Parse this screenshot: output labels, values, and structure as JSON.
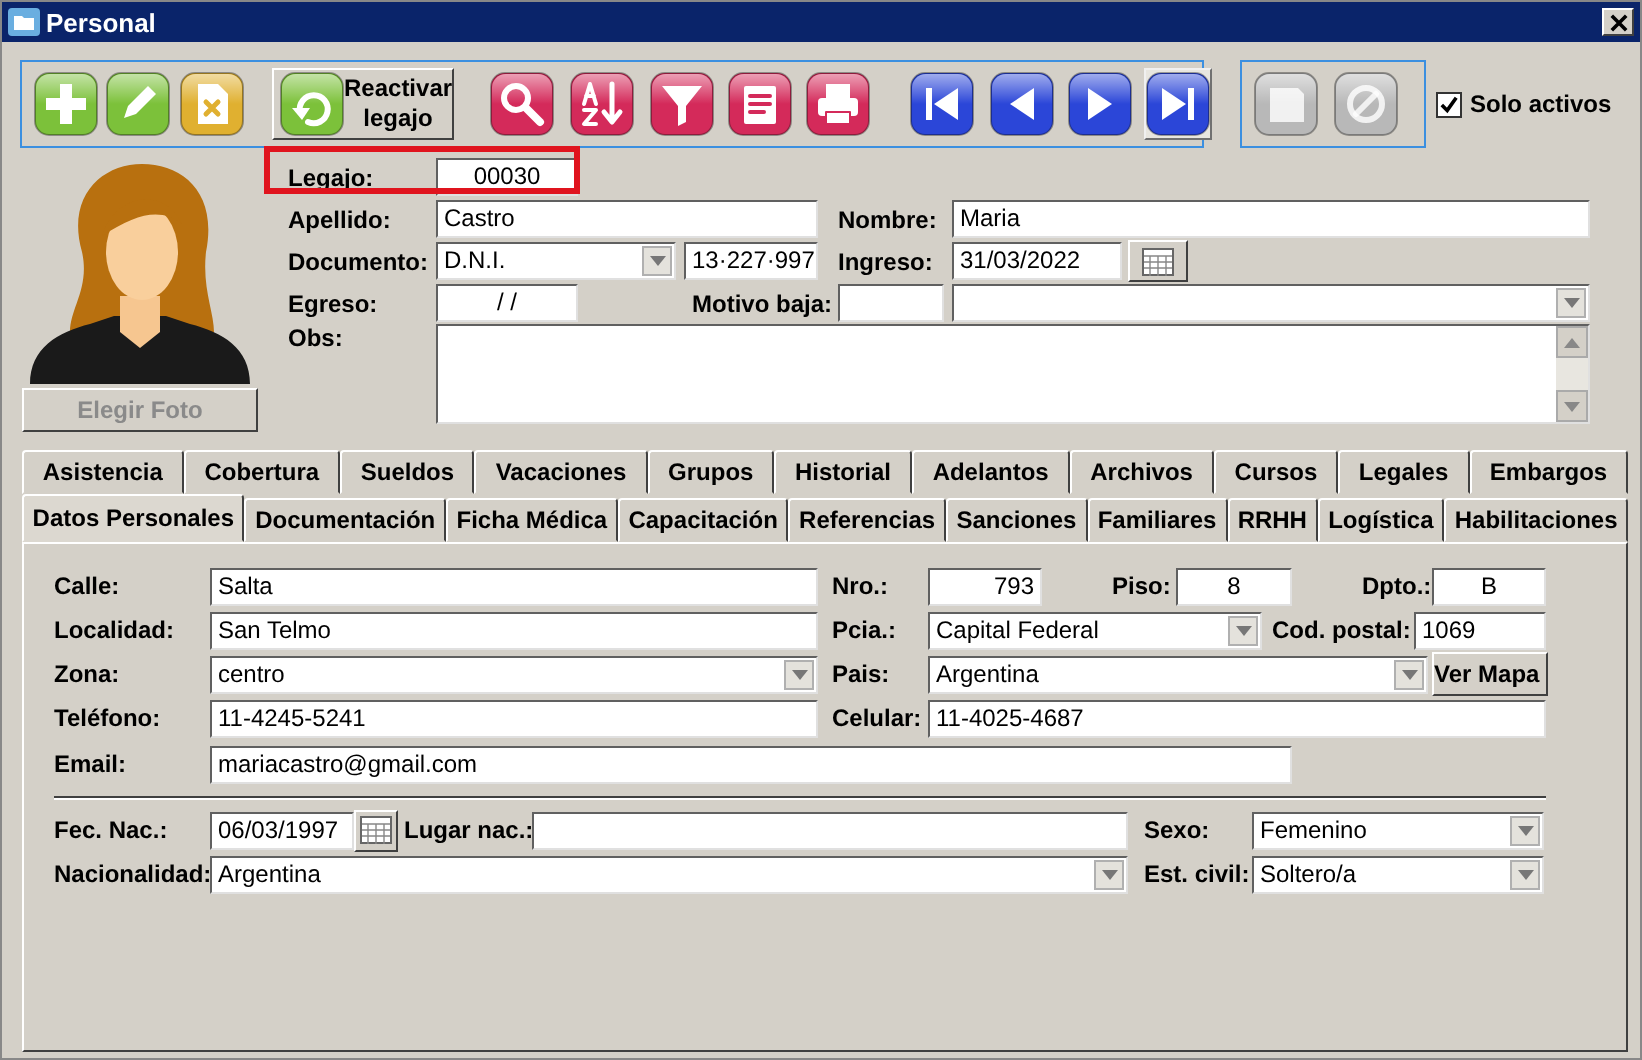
{
  "window": {
    "title": "Personal"
  },
  "toolbar": {
    "groups": [
      {
        "buttons": [
          {
            "kind": "add",
            "color": "#7cc13a",
            "disabled": false,
            "hovered": false
          },
          {
            "kind": "edit",
            "color": "#7cc13a",
            "disabled": false,
            "hovered": false
          },
          {
            "kind": "delete",
            "color": "#e0b030",
            "disabled": false,
            "hovered": false
          },
          {
            "kind": "reactivate",
            "color": "#7cc13a",
            "label": "Reactivar legajo",
            "disabled": false,
            "hovered": false
          },
          {
            "kind": "search",
            "color": "#d42a5a",
            "disabled": false,
            "hovered": false
          },
          {
            "kind": "sort",
            "color": "#d42a5a",
            "disabled": false,
            "hovered": false
          },
          {
            "kind": "filter",
            "color": "#d42a5a",
            "disabled": false,
            "hovered": false
          },
          {
            "kind": "report",
            "color": "#d42a5a",
            "disabled": false,
            "hovered": false
          },
          {
            "kind": "print",
            "color": "#d42a5a",
            "disabled": false,
            "hovered": false
          },
          {
            "kind": "first",
            "color": "#2b46d8",
            "disabled": false,
            "hovered": false
          },
          {
            "kind": "previous",
            "color": "#2b46d8",
            "disabled": false,
            "hovered": false
          },
          {
            "kind": "next",
            "color": "#2b46d8",
            "disabled": false,
            "hovered": false
          },
          {
            "kind": "last",
            "color": "#2b46d8",
            "disabled": false,
            "hovered": true
          }
        ]
      },
      {
        "buttons": [
          {
            "kind": "save",
            "disabled": true,
            "hovered": false
          },
          {
            "kind": "cancel",
            "disabled": true,
            "hovered": false
          }
        ]
      }
    ],
    "only_active": {
      "label": "Solo activos",
      "checked": true
    }
  },
  "photo": {
    "button": "Elegir Foto",
    "disabled": true
  },
  "header": {
    "rows": [
      {
        "highlighted": true,
        "items": [
          {
            "kind": "label",
            "text": "Legajo:"
          },
          {
            "kind": "text",
            "value": "00030"
          }
        ]
      },
      {
        "highlighted": false,
        "items": [
          {
            "kind": "label",
            "text": "Apellido:"
          },
          {
            "kind": "text",
            "value": "Castro"
          },
          {
            "kind": "label",
            "text": "Nombre:"
          },
          {
            "kind": "text",
            "value": "Maria"
          }
        ]
      },
      {
        "highlighted": false,
        "items": [
          {
            "kind": "label",
            "text": "Documento:"
          },
          {
            "kind": "combo",
            "value": "D.N.I."
          },
          {
            "kind": "text",
            "value": "13·227·997"
          },
          {
            "kind": "label",
            "text": "Ingreso:"
          },
          {
            "kind": "date",
            "value": "31/03/2022"
          }
        ]
      },
      {
        "highlighted": false,
        "items": [
          {
            "kind": "label",
            "text": "Egreso:"
          },
          {
            "kind": "text",
            "value": "/ /"
          },
          {
            "kind": "label",
            "text": "Motivo baja:"
          },
          {
            "kind": "text"
          },
          {
            "kind": "combo"
          }
        ]
      },
      {
        "highlighted": false,
        "items": [
          {
            "kind": "label",
            "text": "Obs:"
          },
          {
            "kind": "memo"
          }
        ]
      }
    ]
  },
  "tabs": [
    [
      {
        "label": "Asistencia",
        "selected": false
      },
      {
        "label": "Cobertura",
        "selected": false
      },
      {
        "label": "Sueldos",
        "selected": false
      },
      {
        "label": "Vacaciones",
        "selected": false
      },
      {
        "label": "Grupos",
        "selected": false
      },
      {
        "label": "Historial",
        "selected": false
      },
      {
        "label": "Adelantos",
        "selected": false
      },
      {
        "label": "Archivos",
        "selected": false
      },
      {
        "label": "Cursos",
        "selected": false
      },
      {
        "label": "Legales",
        "selected": false
      },
      {
        "label": "Embargos",
        "selected": false
      }
    ],
    [
      {
        "label": "Datos Personales",
        "selected": true
      },
      {
        "label": "Documentación",
        "selected": false
      },
      {
        "label": "Ficha Médica",
        "selected": false
      },
      {
        "label": "Capacitación",
        "selected": false
      },
      {
        "label": "Referencias",
        "selected": false
      },
      {
        "label": "Sanciones",
        "selected": false
      },
      {
        "label": "Familiares",
        "selected": false
      },
      {
        "label": "RRHH",
        "selected": false
      },
      {
        "label": "Logística",
        "selected": false
      },
      {
        "label": "Habilitaciones",
        "selected": false
      }
    ]
  ],
  "panel": {
    "rows": [
      {
        "items": [
          {
            "kind": "label",
            "text": "Calle:"
          },
          {
            "kind": "text",
            "value": "Salta"
          },
          {
            "kind": "label",
            "text": "Nro.:"
          },
          {
            "kind": "text",
            "value": "793"
          },
          {
            "kind": "label",
            "text": "Piso:"
          },
          {
            "kind": "text",
            "value": "8"
          },
          {
            "kind": "label",
            "text": "Dpto.:"
          },
          {
            "kind": "text",
            "value": "B"
          }
        ]
      },
      {
        "items": [
          {
            "kind": "label",
            "text": "Localidad:"
          },
          {
            "kind": "text",
            "value": "San Telmo"
          },
          {
            "kind": "label",
            "text": "Pcia.:"
          },
          {
            "kind": "combo",
            "value": "Capital Federal"
          },
          {
            "kind": "label",
            "text": "Cod. postal:"
          },
          {
            "kind": "text",
            "value": "1069"
          }
        ]
      },
      {
        "items": [
          {
            "kind": "label",
            "text": "Zona:"
          },
          {
            "kind": "combo",
            "value": "centro"
          },
          {
            "kind": "label",
            "text": "Pais:"
          },
          {
            "kind": "combo",
            "value": "Argentina"
          },
          {
            "kind": "button",
            "text": "Ver Mapa"
          }
        ]
      },
      {
        "items": [
          {
            "kind": "label",
            "text": "Teléfono:"
          },
          {
            "kind": "text",
            "value": "11-4245-5241"
          },
          {
            "kind": "label",
            "text": "Celular:"
          },
          {
            "kind": "text",
            "value": "11-4025-4687"
          }
        ]
      },
      {
        "items": [
          {
            "kind": "label",
            "text": "Email:"
          },
          {
            "kind": "text",
            "value": "mariacastro@gmail.com"
          }
        ]
      },
      {
        "items": [
          {
            "kind": "divider"
          }
        ]
      },
      {
        "items": [
          {
            "kind": "label",
            "text": "Fec. Nac.:"
          },
          {
            "kind": "date",
            "value": "06/03/1997"
          },
          {
            "kind": "label",
            "text": "Lugar nac.:"
          },
          {
            "kind": "text"
          },
          {
            "kind": "label",
            "text": "Sexo:"
          },
          {
            "kind": "combo",
            "value": "Femenino"
          }
        ]
      },
      {
        "items": [
          {
            "kind": "label",
            "text": "Nacionalidad:"
          },
          {
            "kind": "combo",
            "value": "Argentina"
          },
          {
            "kind": "label",
            "text": "Est. civil:"
          },
          {
            "kind": "combo",
            "value": "Soltero/a"
          }
        ]
      }
    ]
  }
}
